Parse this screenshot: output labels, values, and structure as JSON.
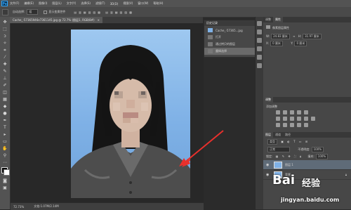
{
  "app": {
    "logo": "Ps"
  },
  "menu": [
    "文件(F)",
    "编辑(E)",
    "图像(I)",
    "图层(L)",
    "文字(Y)",
    "选择(S)",
    "滤镜(T)",
    "3D(D)",
    "视图(V)",
    "窗口(W)",
    "帮助(H)"
  ],
  "options": {
    "mode_label": "自动选择:",
    "mode_value": "组",
    "transform_label": "显示变换控件"
  },
  "document_tab": {
    "title": "Cache_-57365946e7361145.jpg @ 72.7% (图层1, RGB/8#)",
    "close": "×"
  },
  "status": {
    "zoom": "72.73%",
    "doc": "文档:1.07M/2.14M"
  },
  "history": {
    "tab_label": "历史记录",
    "doc_name": "Cache_-57365...jpg",
    "items": [
      "打开",
      "通过拷贝的图层",
      "魔棒选择"
    ]
  },
  "properties": {
    "tabs": [
      "调整",
      "属性"
    ],
    "header": "像素图层属性",
    "w_label": "W:",
    "w_value": "24.83 厘米",
    "h_label": "H:",
    "h_value": "31.97 厘米",
    "x_label": "X:",
    "x_value": "0 厘米",
    "y_label": "Y:",
    "y_value": "0 厘米"
  },
  "adjustments": {
    "tab_label": "调整",
    "subtitle": "添加调整"
  },
  "layers": {
    "tabs": [
      "图层",
      "通道",
      "路径"
    ],
    "kind_label": "类型",
    "blend_mode": "正常",
    "opacity_label": "不透明度:",
    "opacity_value": "100%",
    "lock_label": "锁定:",
    "fill_label": "填充:",
    "fill_value": "100%",
    "items": [
      {
        "name": "图层 1"
      },
      {
        "name": "背景"
      }
    ]
  },
  "watermark": {
    "brand": "Bai",
    "brand2": "经验",
    "url": "jingyan.baidu.com"
  },
  "colors": {
    "accent": "#31a8ff",
    "arrow": "#e8302c",
    "photo_bg": "#7fb1e6"
  }
}
